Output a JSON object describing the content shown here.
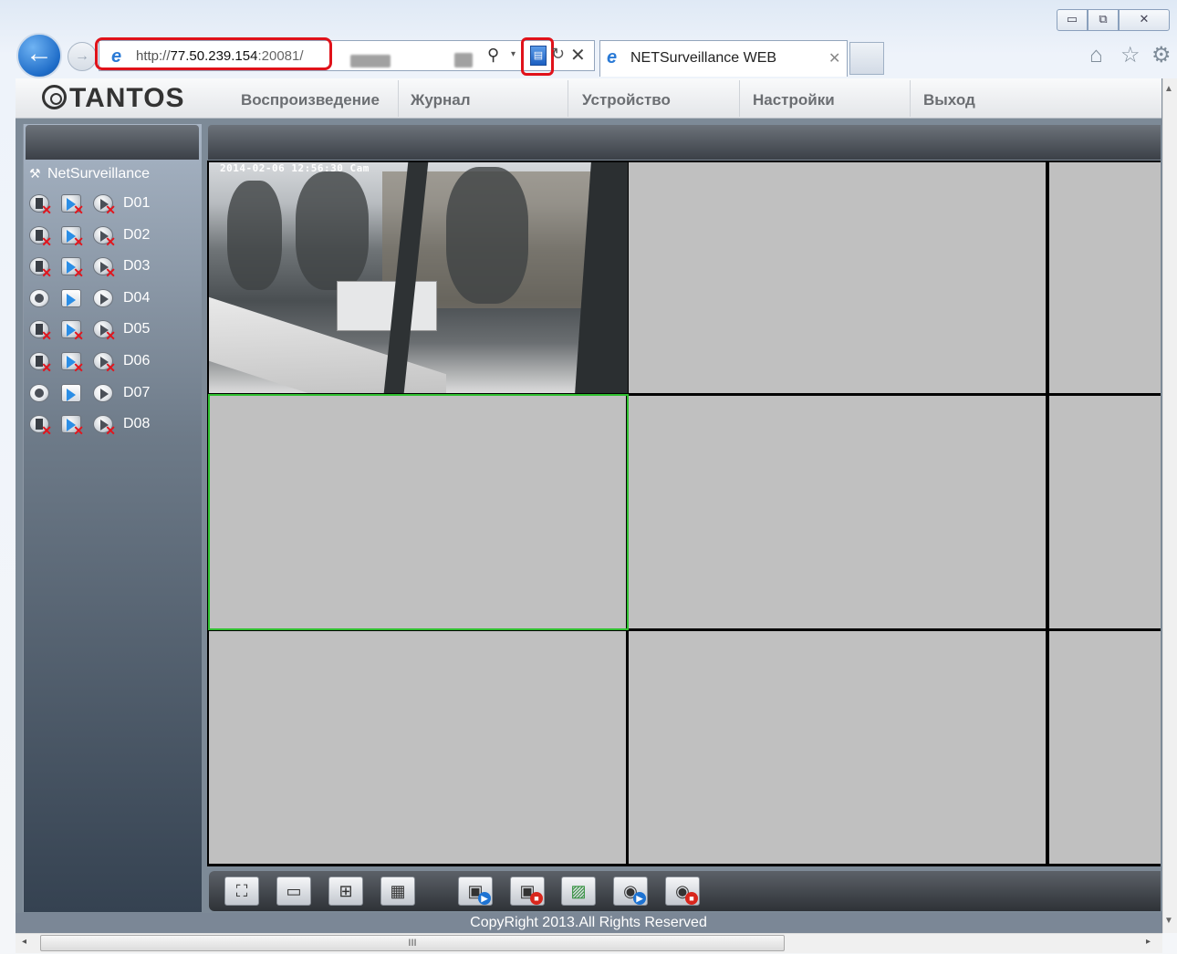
{
  "browser": {
    "url_prefix": "http://",
    "url_host": "77.50.239.154",
    "url_port": ":20081/",
    "tab_title": "NETSurveillance WEB",
    "window_controls": {
      "minimize": "▭",
      "maximize": "⧉",
      "close": "✕"
    }
  },
  "app": {
    "logo": "TANTOS",
    "menu": [
      "Воспроизведение",
      "Журнал",
      "Устройство",
      "Настройки",
      "Выход"
    ],
    "tree_root": "NetSurveillance",
    "channels": [
      {
        "name": "D01",
        "online": false
      },
      {
        "name": "D02",
        "online": false
      },
      {
        "name": "D03",
        "online": false
      },
      {
        "name": "D04",
        "online": true
      },
      {
        "name": "D05",
        "online": false
      },
      {
        "name": "D06",
        "online": false
      },
      {
        "name": "D07",
        "online": true
      },
      {
        "name": "D08",
        "online": false
      }
    ],
    "camera_timestamp": "2014-02-06 12:56:30 Cam",
    "footer": "CopyRight 2013.All Rights Reserved",
    "accent_colors": {
      "highlight_red": "#e0121a",
      "selected_cell": "#2fbf2f"
    }
  }
}
